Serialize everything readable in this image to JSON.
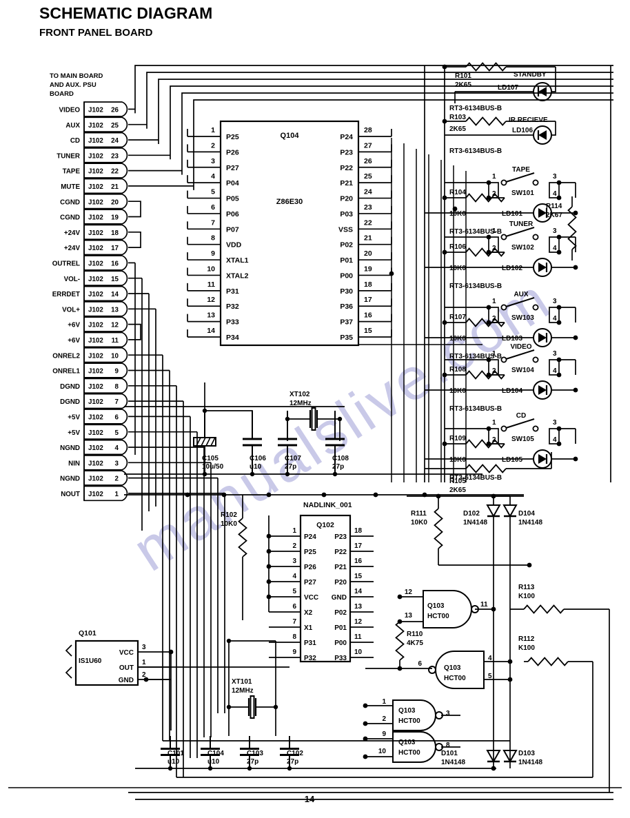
{
  "page": {
    "title": "SCHEMATIC DIAGRAM",
    "subtitle": "FRONT PANEL BOARD",
    "page_number": "14",
    "watermark": "manualslive.com"
  },
  "connector": {
    "note_line1": "TO MAIN BOARD",
    "note_line2": "AND AUX. PSU",
    "note_line3": "BOARD",
    "ref": "J102",
    "pins": [
      {
        "signal": "VIDEO",
        "ref": "J102",
        "pin": "26"
      },
      {
        "signal": "AUX",
        "ref": "J102",
        "pin": "25"
      },
      {
        "signal": "CD",
        "ref": "J102",
        "pin": "24"
      },
      {
        "signal": "TUNER",
        "ref": "J102",
        "pin": "23"
      },
      {
        "signal": "TAPE",
        "ref": "J102",
        "pin": "22"
      },
      {
        "signal": "MUTE",
        "ref": "J102",
        "pin": "21"
      },
      {
        "signal": "CGND",
        "ref": "J102",
        "pin": "20"
      },
      {
        "signal": "CGND",
        "ref": "J102",
        "pin": "19"
      },
      {
        "signal": "+24V",
        "ref": "J102",
        "pin": "18"
      },
      {
        "signal": "+24V",
        "ref": "J102",
        "pin": "17"
      },
      {
        "signal": "OUTREL",
        "ref": "J102",
        "pin": "16"
      },
      {
        "signal": "VOL-",
        "ref": "J102",
        "pin": "15"
      },
      {
        "signal": "ERRDET",
        "ref": "J102",
        "pin": "14"
      },
      {
        "signal": "VOL+",
        "ref": "J102",
        "pin": "13"
      },
      {
        "signal": "+6V",
        "ref": "J102",
        "pin": "12"
      },
      {
        "signal": "+6V",
        "ref": "J102",
        "pin": "11"
      },
      {
        "signal": "ONREL2",
        "ref": "J102",
        "pin": "10"
      },
      {
        "signal": "ONREL1",
        "ref": "J102",
        "pin": "9"
      },
      {
        "signal": "DGND",
        "ref": "J102",
        "pin": "8"
      },
      {
        "signal": "DGND",
        "ref": "J102",
        "pin": "7"
      },
      {
        "signal": "+5V",
        "ref": "J102",
        "pin": "6"
      },
      {
        "signal": "+5V",
        "ref": "J102",
        "pin": "5"
      },
      {
        "signal": "NGND",
        "ref": "J102",
        "pin": "4"
      },
      {
        "signal": "NIN",
        "ref": "J102",
        "pin": "3"
      },
      {
        "signal": "NGND",
        "ref": "J102",
        "pin": "2"
      },
      {
        "signal": "NOUT",
        "ref": "J102",
        "pin": "1"
      }
    ]
  },
  "q104": {
    "ref": "Q104",
    "part": "Z86E30",
    "left_pins": [
      {
        "num": "1",
        "name": "P25"
      },
      {
        "num": "2",
        "name": "P26"
      },
      {
        "num": "3",
        "name": "P27"
      },
      {
        "num": "4",
        "name": "P04"
      },
      {
        "num": "5",
        "name": "P05"
      },
      {
        "num": "6",
        "name": "P06"
      },
      {
        "num": "7",
        "name": "P07"
      },
      {
        "num": "8",
        "name": "VDD"
      },
      {
        "num": "9",
        "name": "XTAL1"
      },
      {
        "num": "10",
        "name": "XTAL2"
      },
      {
        "num": "11",
        "name": "P31"
      },
      {
        "num": "12",
        "name": "P32"
      },
      {
        "num": "13",
        "name": "P33"
      },
      {
        "num": "14",
        "name": "P34"
      }
    ],
    "right_pins": [
      {
        "num": "28",
        "name": "P24"
      },
      {
        "num": "27",
        "name": "P23"
      },
      {
        "num": "26",
        "name": "P22"
      },
      {
        "num": "25",
        "name": "P21"
      },
      {
        "num": "24",
        "name": "P20"
      },
      {
        "num": "23",
        "name": "P03"
      },
      {
        "num": "22",
        "name": "VSS"
      },
      {
        "num": "21",
        "name": "P02"
      },
      {
        "num": "20",
        "name": "P01"
      },
      {
        "num": "19",
        "name": "P00"
      },
      {
        "num": "18",
        "name": "P30"
      },
      {
        "num": "17",
        "name": "P36"
      },
      {
        "num": "16",
        "name": "P37"
      },
      {
        "num": "15",
        "name": "P35"
      }
    ]
  },
  "q102": {
    "ref": "Q102",
    "part": "NADLINK_001",
    "left_pins": [
      {
        "num": "1",
        "name": "P24"
      },
      {
        "num": "2",
        "name": "P25"
      },
      {
        "num": "3",
        "name": "P26"
      },
      {
        "num": "4",
        "name": "P27"
      },
      {
        "num": "5",
        "name": "VCC"
      },
      {
        "num": "6",
        "name": "X2"
      },
      {
        "num": "7",
        "name": "X1"
      },
      {
        "num": "8",
        "name": "P31"
      },
      {
        "num": "9",
        "name": "P32"
      }
    ],
    "right_pins": [
      {
        "num": "18",
        "name": "P23"
      },
      {
        "num": "17",
        "name": "P22"
      },
      {
        "num": "16",
        "name": "P21"
      },
      {
        "num": "15",
        "name": "P20"
      },
      {
        "num": "14",
        "name": "GND"
      },
      {
        "num": "13",
        "name": "P02"
      },
      {
        "num": "12",
        "name": "P01"
      },
      {
        "num": "11",
        "name": "P00"
      },
      {
        "num": "10",
        "name": "P33"
      }
    ]
  },
  "q101": {
    "ref": "Q101",
    "part": "IS1U60",
    "pins": [
      {
        "num": "3",
        "name": "VCC"
      },
      {
        "num": "1",
        "name": "OUT"
      },
      {
        "num": "2",
        "name": "GND"
      }
    ]
  },
  "gates": [
    {
      "ref": "Q103",
      "part": "HCT00",
      "in_a": "12",
      "in_b": "13",
      "out": "11"
    },
    {
      "ref": "Q103",
      "part": "HCT00",
      "in_a": "4",
      "in_b": "5",
      "out": "6"
    },
    {
      "ref": "Q103",
      "part": "HCT00",
      "in_a": "1",
      "in_b": "2",
      "out": "3"
    },
    {
      "ref": "Q103",
      "part": "HCT00",
      "in_a": "9",
      "in_b": "10",
      "out": "8"
    }
  ],
  "led_rows": [
    {
      "ref": "LD107",
      "label": "STANDBY",
      "part": "RT3-6134BUS-B",
      "res_ref": "R101",
      "res_val": "2K65",
      "sw": null
    },
    {
      "ref": "LD106",
      "label": "IR RECIEVE",
      "part": "RT3-6134BUS-B",
      "res_ref": "R103",
      "res_val": "2K65",
      "sw": null
    },
    {
      "ref": "LD101",
      "label": "TAPE",
      "part": "RT3-6134BUS-B",
      "res_ref": "R104",
      "res_val": "10K0",
      "sw": "SW101"
    },
    {
      "ref": "LD102",
      "label": "TUNER",
      "part": "RT3-6134BUS-B",
      "res_ref": "R106",
      "res_val": "10K0",
      "sw": "SW102"
    },
    {
      "ref": "LD103",
      "label": "AUX",
      "part": "RT3-6134BUS-B",
      "res_ref": "R107",
      "res_val": "10K0",
      "sw": "SW103"
    },
    {
      "ref": "LD104",
      "label": "VIDEO",
      "part": "RT3-6134BUS-B",
      "res_ref": "R108",
      "res_val": "10K0",
      "sw": "SW104"
    },
    {
      "ref": "LD105",
      "label": "CD",
      "part": "RT3-6134BUS-B",
      "res_ref": "R109",
      "res_val": "10K0",
      "sw": "SW105"
    }
  ],
  "switch_pin_labels": {
    "p1": "1",
    "p2": "2",
    "p3": "3",
    "p4": "4"
  },
  "resistors": [
    {
      "ref": "R101",
      "value": "2K65"
    },
    {
      "ref": "R102",
      "value": "10K0"
    },
    {
      "ref": "R103",
      "value": "2K65"
    },
    {
      "ref": "R104",
      "value": "10K0"
    },
    {
      "ref": "R105",
      "value": "2K65"
    },
    {
      "ref": "R106",
      "value": "10K0"
    },
    {
      "ref": "R107",
      "value": "10K0"
    },
    {
      "ref": "R108",
      "value": "10K0"
    },
    {
      "ref": "R109",
      "value": "10K0"
    },
    {
      "ref": "R110",
      "value": "4K75"
    },
    {
      "ref": "R111",
      "value": "10K0"
    },
    {
      "ref": "R112",
      "value": "K100"
    },
    {
      "ref": "R113",
      "value": "K100"
    },
    {
      "ref": "R114",
      "value": "2K67"
    }
  ],
  "capacitors": [
    {
      "ref": "C101",
      "value": "u10"
    },
    {
      "ref": "C102",
      "value": "27p"
    },
    {
      "ref": "C103",
      "value": "27p"
    },
    {
      "ref": "C104",
      "value": "u10"
    },
    {
      "ref": "C105",
      "value": "10u/50"
    },
    {
      "ref": "C106",
      "value": "u10"
    },
    {
      "ref": "C107",
      "value": "27p"
    },
    {
      "ref": "C108",
      "value": "27p"
    }
  ],
  "crystals": [
    {
      "ref": "XT101",
      "value": "12MHz"
    },
    {
      "ref": "XT102",
      "value": "12MHz"
    }
  ],
  "diodes": [
    {
      "ref": "D101",
      "part": "1N4148"
    },
    {
      "ref": "D102",
      "part": "1N4148"
    },
    {
      "ref": "D103",
      "part": "1N4148"
    },
    {
      "ref": "D104",
      "part": "1N4148"
    }
  ],
  "colors": {
    "ink": "#000000",
    "paper": "#ffffff",
    "watermark": "#c9c9e8"
  }
}
